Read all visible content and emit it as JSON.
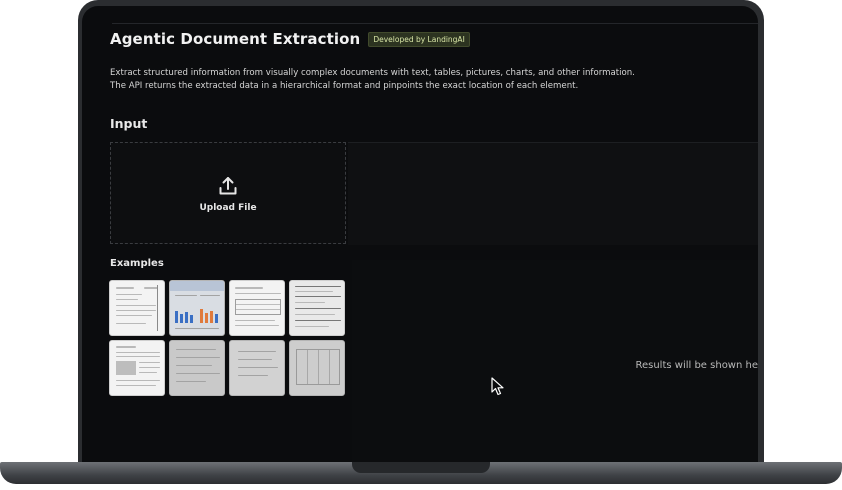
{
  "app": {
    "title": "Agentic Document Extraction",
    "badge": "Developed by LandingAI",
    "description_line1": "Extract structured information from visually complex documents with text, tables, pictures, charts, and other information.",
    "description_line2": "The API returns the extracted data in a hierarchical format and pinpoints the exact location of each element."
  },
  "input": {
    "section_title": "Input",
    "upload_label": "Upload File",
    "upload_icon": "upload-icon"
  },
  "examples": {
    "title": "Examples",
    "items": [
      {
        "kind": "invoice-document"
      },
      {
        "kind": "bar-chart-report"
      },
      {
        "kind": "table-document"
      },
      {
        "kind": "form-document"
      },
      {
        "kind": "paper-document"
      },
      {
        "kind": "handwritten-form"
      },
      {
        "kind": "scanned-page"
      },
      {
        "kind": "scanned-table"
      }
    ]
  },
  "results": {
    "placeholder": "Results will be shown he"
  },
  "colors": {
    "screen_bg": "#0b0c0e",
    "badge_bg": "#2c3320",
    "badge_text": "#d8e6a6",
    "bar_blue": "#3a6fc4",
    "bar_orange": "#e07a3c"
  }
}
